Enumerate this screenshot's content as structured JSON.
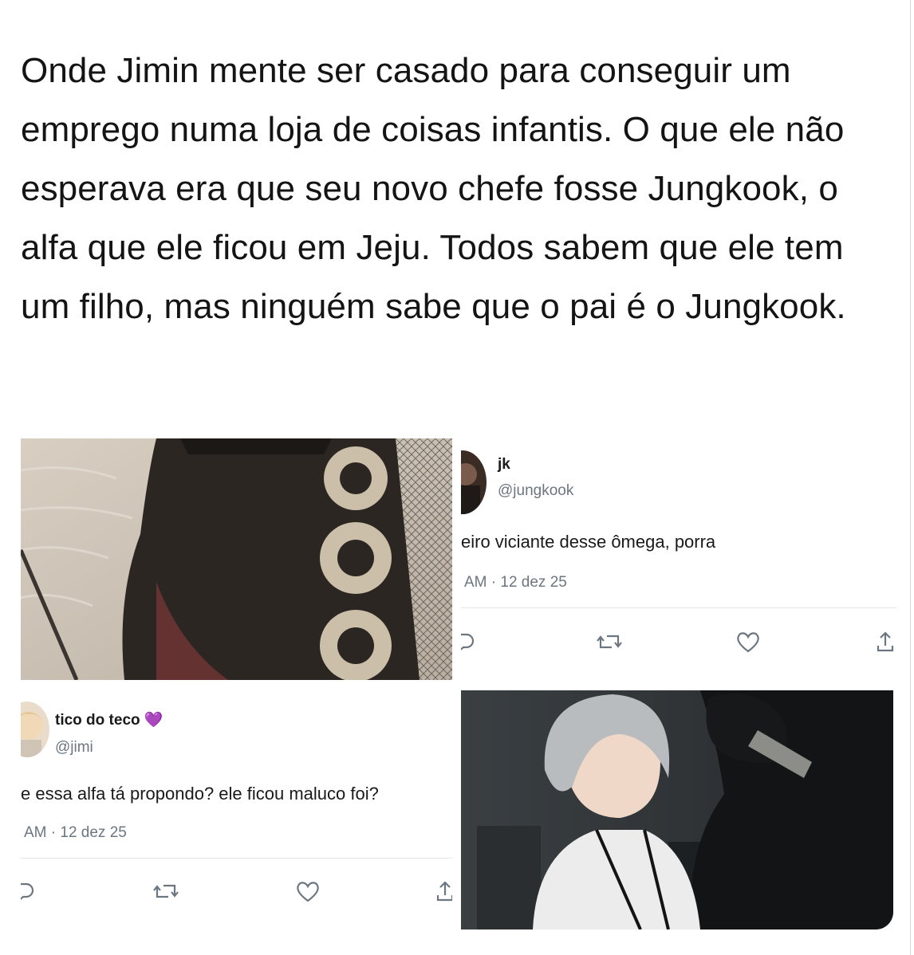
{
  "post": {
    "caption": "Onde Jimin mente ser casado para conseguir um emprego numa loja de coisas infantis. O que ele não esperava era que seu novo chefe fosse Jungkook, o alfa que ele ficou em Jeju. Todos sabem que ele tem um filho, mas ninguém sabe que o pai é o Jungkook."
  },
  "tweet_jk": {
    "name": "jk",
    "handle": "@jungkook",
    "text": "eiro viciante desse ômega, porra",
    "meta": "AM · 12 dez 25"
  },
  "tweet_jimi": {
    "name": "tico do teco 💜",
    "handle": "@jimi",
    "text": "e essa alfa tá propondo? ele ficou maluco foi?",
    "meta": "AM · 12 dez 25"
  },
  "icons": [
    "reply-icon",
    "retweet-icon",
    "heart-icon",
    "share-icon"
  ],
  "colors": {
    "meta_gray": "#6b7680",
    "divider": "#e3e6e8",
    "text": "#141414"
  }
}
